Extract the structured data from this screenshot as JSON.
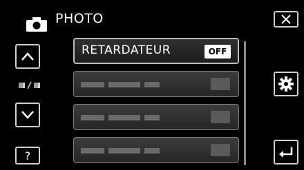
{
  "header": {
    "title": "PHOTO",
    "mode_icon": "camera-icon"
  },
  "nav": {
    "up_icon": "chevron-up-icon",
    "down_icon": "chevron-down-icon",
    "page_indicator_icon": "page-indicator-icon",
    "help_label": "?"
  },
  "menu": {
    "items": [
      {
        "label": "RETARDATEUR",
        "value": "OFF",
        "selected": true
      },
      {
        "label": "",
        "value": "",
        "selected": false
      },
      {
        "label": "",
        "value": "",
        "selected": false
      },
      {
        "label": "",
        "value": "",
        "selected": false
      }
    ]
  },
  "right_controls": {
    "close_icon": "close-icon",
    "settings_icon": "gear-icon",
    "back_icon": "return-icon"
  },
  "colors": {
    "background": "#000000",
    "border": "#cfcfcf",
    "badge": "#ffffff"
  }
}
